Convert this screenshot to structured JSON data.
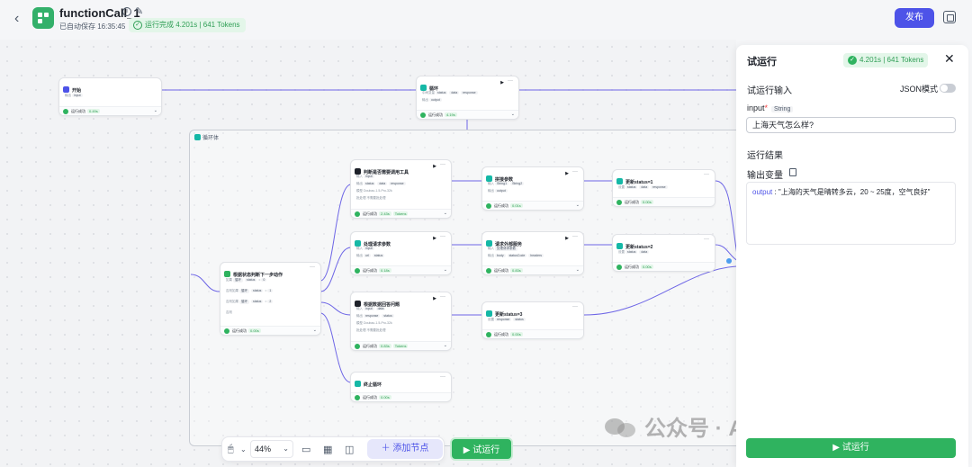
{
  "header": {
    "back_icon": "‹",
    "title": "functionCall_1",
    "autosave": "已自动保存 16:35:45",
    "run_badge": "运行完成 4.201s | 641 Tokens",
    "publish": "发布"
  },
  "canvas": {
    "loop_body_label": "循环体",
    "nodes": {
      "start": {
        "title": "开始",
        "row1_label": "输出",
        "row1_chips": [
          "input"
        ],
        "status": "运行成功",
        "time": "0.49s"
      },
      "loop": {
        "title": "循环",
        "row1_label": "中间变量",
        "row1_chips": [
          "status",
          "data",
          "response"
        ],
        "row2_label": "输出",
        "row2_chips": [
          "output"
        ],
        "status": "运行成功",
        "time": "4.19s"
      },
      "judge_tool": {
        "title": "判断是否需要调用工具",
        "row1_label": "输入",
        "row1_chips": [
          "input"
        ],
        "row2_label": "输出",
        "row2_chips": [
          "status",
          "data",
          "response"
        ],
        "row3_label": "模型",
        "row3_text": "Doubao-1.5-Pro-32k",
        "row4_label": "批处理",
        "row4_text": "不需要批处理",
        "status": "运行成功",
        "time": "2.43s",
        "tokens": "Tokens"
      },
      "concat": {
        "title": "拼接参数",
        "row1_label": "输入",
        "row1_chips": [
          "String1",
          "String2"
        ],
        "row2_label": "输出",
        "row2_chips": [
          "output"
        ],
        "status": "运行成功",
        "time": "0.01s"
      },
      "update1": {
        "title": "更新status=1",
        "row1_label": "设置",
        "row1_chips": [
          "status",
          "data",
          "response"
        ],
        "status": "运行成功",
        "time": "0.00s"
      },
      "process_params": {
        "title": "处理请求参数",
        "row1_label": "输入",
        "row1_chips": [
          "input"
        ],
        "row2_label": "输出",
        "row2_chips": [
          "url",
          "status"
        ],
        "status": "运行成功",
        "time": "0.18s"
      },
      "external": {
        "title": "请求外部服务",
        "row1_label": "输入",
        "row1_chips": [
          "处理请求参数"
        ],
        "row2_label": "输出",
        "row2_chips": [
          "body",
          "statusCode",
          "headers"
        ],
        "status": "运行成功",
        "time": "0.83s"
      },
      "update2": {
        "title": "更新status=2",
        "row1_label": "设置",
        "row1_chips": [
          "status",
          "data"
        ],
        "status": "运行成功",
        "time": "0.00s"
      },
      "router": {
        "title": "根据状态判断下一步动作",
        "rows": [
          {
            "label": "如果",
            "left": "循环",
            "var": "status",
            "op": "=",
            "val": "0"
          },
          {
            "label": "否则如果",
            "left": "循环",
            "var": "status",
            "op": "=",
            "val": "1"
          },
          {
            "label": "否则如果",
            "left": "循环",
            "var": "status",
            "op": "=",
            "val": "2"
          },
          {
            "label": "否则",
            "left": "",
            "var": "",
            "op": "",
            "val": ""
          }
        ],
        "status": "运行成功",
        "time": "0.00s"
      },
      "answer": {
        "title": "根据数据回答问题",
        "row1_label": "输入",
        "row1_chips": [
          "input",
          "data"
        ],
        "row2_label": "输出",
        "row2_chips": [
          "response",
          "status"
        ],
        "row3_label": "模型",
        "row3_text": "Doubao-1.5-Pro-32k",
        "row4_label": "批处理",
        "row4_text": "不需要批处理",
        "status": "运行成功",
        "time": "0.83s",
        "tokens": "Tokens"
      },
      "update3": {
        "title": "更新status=3",
        "row1_label": "设置",
        "row1_chips": [
          "response",
          "status"
        ],
        "status": "运行成功",
        "time": "0.00s"
      },
      "stop_loop": {
        "title": "终止循环",
        "status": "运行成功",
        "time": "0.00s"
      }
    }
  },
  "toolbar": {
    "zoom": "44%",
    "add_node": "添加节点",
    "test_run": "试运行"
  },
  "panel": {
    "title": "试运行",
    "badge": "4.201s | 641 Tokens",
    "input_section": "试运行输入",
    "json_mode": "JSON模式",
    "input_label": "input",
    "input_required": "*",
    "input_type": "String",
    "input_value": "上海天气怎么样?",
    "result_section": "运行结果",
    "output_label": "输出变量",
    "output_key": "output",
    "output_value": "\"上海的天气是晴转多云，20 ~ 25度，空气良好\"",
    "run_button": "试运行"
  },
  "watermark": "公众号 · AI-Tech实验室",
  "colors": {
    "accent": "#4d53e8",
    "success": "#2fb35f",
    "edge": "#6e66e6"
  }
}
